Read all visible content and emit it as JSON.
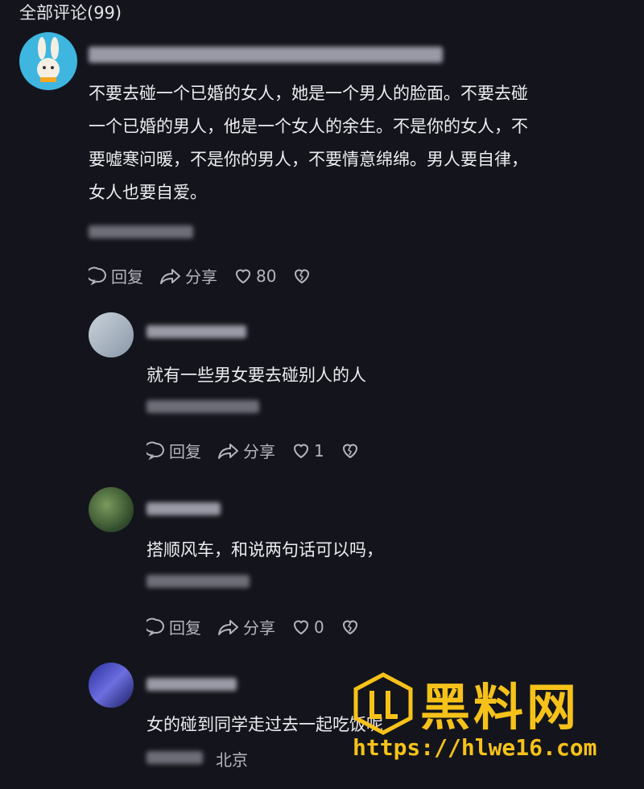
{
  "header": {
    "title": "全部评论(99)"
  },
  "comments": [
    {
      "text_lines": [
        "不要去碰一个已婚的女人，她是一个男人的脸面。不要去碰",
        "一个已婚的男人，他是一个女人的余生。不是你的女人，不",
        "要嘘寒问暖，不是你的男人，不要情意绵绵。男人要自律，",
        "女人也要自爱。"
      ],
      "reply_label": "回复",
      "share_label": "分享",
      "likes": "80"
    },
    {
      "text": "就有一些男女要去碰别人的人",
      "reply_label": "回复",
      "share_label": "分享",
      "likes": "1"
    },
    {
      "text": "搭顺风车，和说两句话可以吗，",
      "reply_label": "回复",
      "share_label": "分享",
      "likes": "0"
    },
    {
      "text": "女的碰到同学走过去一起吃饭呢",
      "location": "北京"
    }
  ],
  "watermark": {
    "title": "黑料网",
    "url": "https://hlwe16.com"
  },
  "colors": {
    "background": "#14151c",
    "watermark": "#f6c21a"
  }
}
